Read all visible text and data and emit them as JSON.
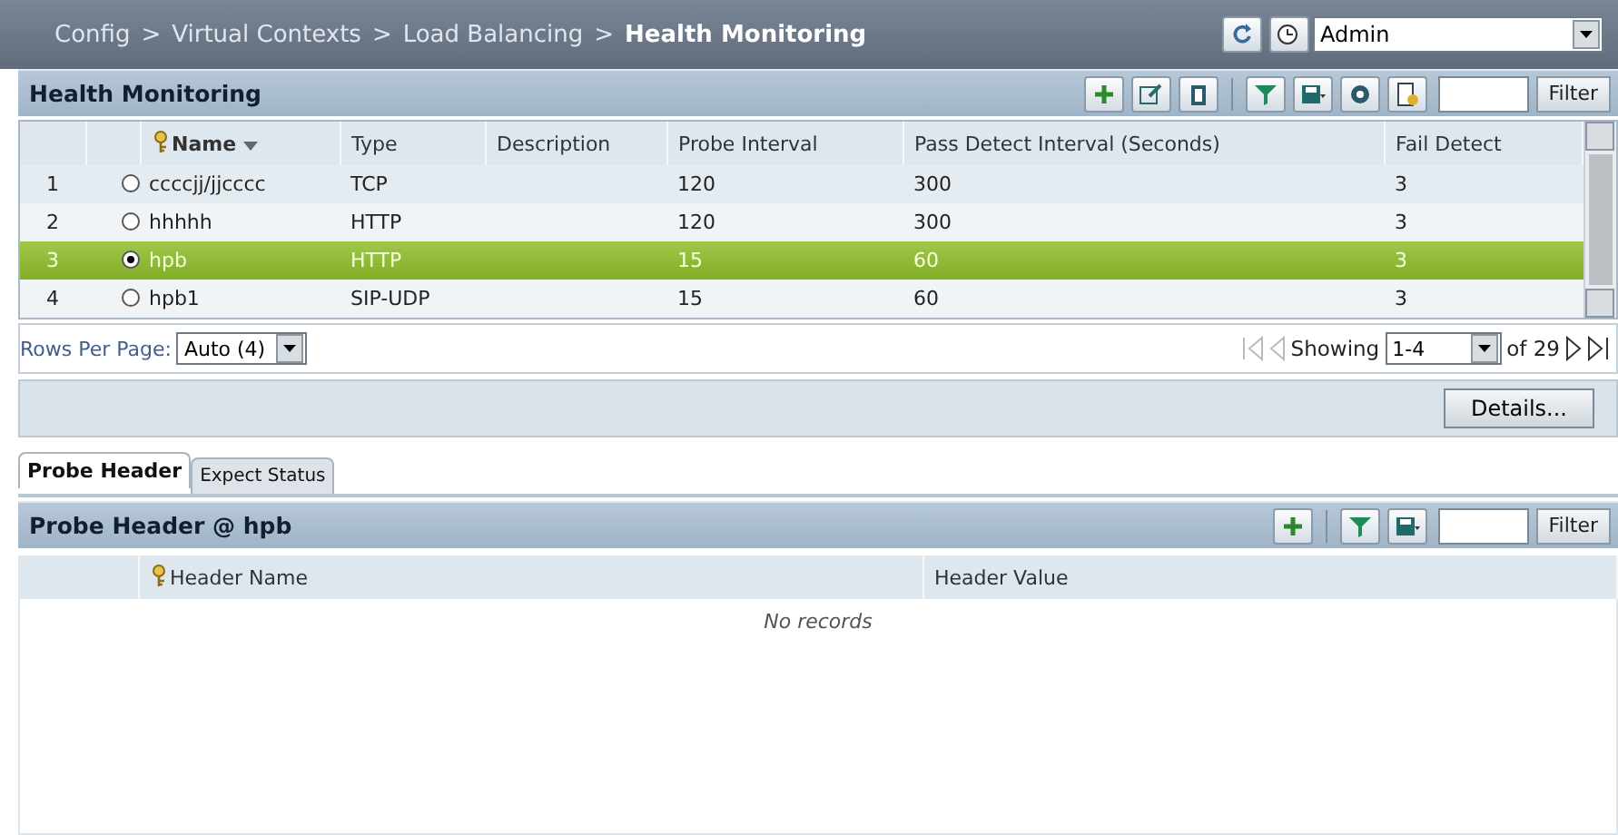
{
  "breadcrumb": [
    {
      "text": "Config",
      "current": false
    },
    {
      "text": "Virtual Contexts",
      "current": false
    },
    {
      "text": "Load Balancing",
      "current": false
    },
    {
      "text": "Health Monitoring",
      "current": true
    }
  ],
  "breadcrumb_separator": ">",
  "context_select": {
    "value": "Admin"
  },
  "main_panel": {
    "title": "Health Monitoring",
    "filter_button": "Filter",
    "columns": [
      "Name",
      "Type",
      "Description",
      "Probe Interval",
      "Pass Detect Interval (Seconds)",
      "Fail Detect"
    ],
    "rows": [
      {
        "index": "1",
        "name": "ccccjj/jjcccc",
        "type": "TCP",
        "probe_interval": "120",
        "pass_detect_interval": "300",
        "fail_detect": "3",
        "selected": false
      },
      {
        "index": "2",
        "name": "hhhhh",
        "type": "HTTP",
        "probe_interval": "120",
        "pass_detect_interval": "300",
        "fail_detect": "3",
        "selected": false
      },
      {
        "index": "3",
        "name": "hpb",
        "type": "HTTP",
        "probe_interval": "15",
        "pass_detect_interval": "60",
        "fail_detect": "3",
        "selected": true
      },
      {
        "index": "4",
        "name": "hpb1",
        "type": "SIP-UDP",
        "probe_interval": "15",
        "pass_detect_interval": "60",
        "fail_detect": "3",
        "selected": false
      }
    ],
    "rows_per_page_label": "Rows Per Page:",
    "rows_per_page": "Auto (4)",
    "showing_label": "Showing",
    "showing_range": "1-4",
    "total": "of 29",
    "details_button": "Details..."
  },
  "tabs": [
    {
      "label": "Probe Header",
      "selected": true
    },
    {
      "label": "Expect Status",
      "selected": false
    }
  ],
  "sub_panel": {
    "title": "Probe Header @ hpb",
    "filter_button": "Filter",
    "columns": [
      "Header Name",
      "Header Value"
    ],
    "empty_message": "No records"
  }
}
